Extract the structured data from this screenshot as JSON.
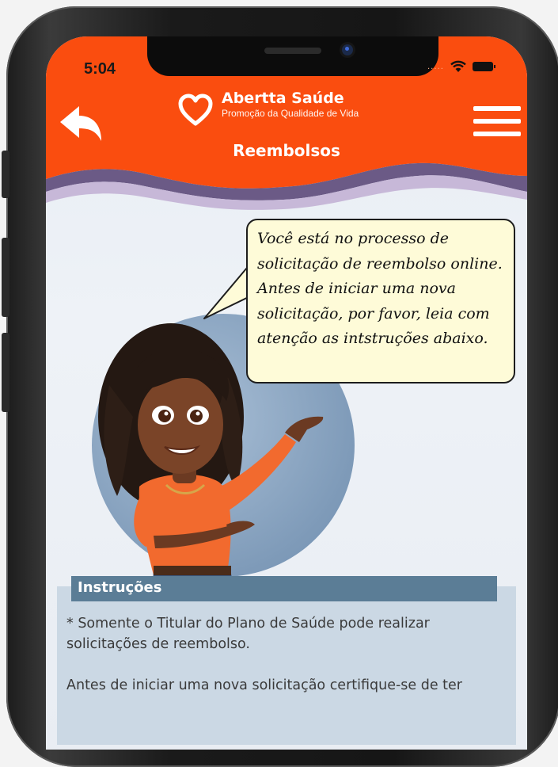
{
  "status_bar": {
    "time": "5:04",
    "signal_dots": "....."
  },
  "header": {
    "brand_name": "Abertta Saúde",
    "brand_tagline": "Promoção da Qualidade de Vida",
    "page_title": "Reembolsos"
  },
  "speech_bubble": {
    "lines": [
      "Você está no processo de",
      "solicitação de reembolso online.",
      "Antes de iniciar uma nova",
      "solicitação, por favor, leia com",
      "atenção as intstruções abaixo."
    ]
  },
  "instructions": {
    "title": "Instruções",
    "item_1": "* Somente o Titular do Plano de Saúde pode realizar solicitações de reembolso.",
    "item_2": "Antes de iniciar uma nova solicitação certifique-se de ter"
  },
  "colors": {
    "header_orange": "#fa4d0f",
    "wave_purple": "#6b5a86",
    "bubble_bg": "#fefbd8",
    "instructions_header": "#5b7d96",
    "instructions_bg": "#cbd8e4"
  },
  "icons": [
    "back-arrow-icon",
    "heart-icon",
    "menu-icon",
    "wifi-icon",
    "battery-icon"
  ]
}
